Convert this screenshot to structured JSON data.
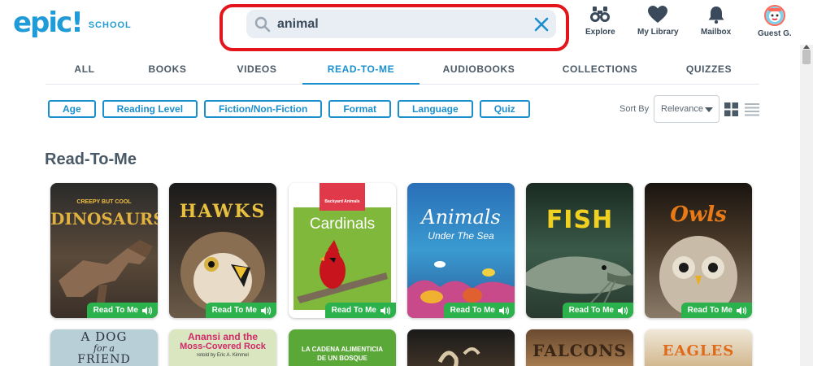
{
  "logo": {
    "word": "epic!",
    "sub": "SCHOOL"
  },
  "search": {
    "value": "animal",
    "placeholder": "Search"
  },
  "nav": {
    "explore": "Explore",
    "library": "My Library",
    "mailbox": "Mailbox",
    "guest": "Guest G."
  },
  "tabs": [
    {
      "label": "ALL"
    },
    {
      "label": "BOOKS"
    },
    {
      "label": "VIDEOS"
    },
    {
      "label": "READ-TO-ME"
    },
    {
      "label": "AUDIOBOOKS"
    },
    {
      "label": "COLLECTIONS"
    },
    {
      "label": "QUIZZES"
    }
  ],
  "active_tab": "READ-TO-ME",
  "filters": [
    "Age",
    "Reading Level",
    "Fiction/Non-Fiction",
    "Format",
    "Language",
    "Quiz"
  ],
  "sort": {
    "label": "Sort By",
    "value": "Relevance"
  },
  "section_title": "Read-To-Me",
  "badge_label": "Read To Me",
  "books_row1": [
    {
      "title": "DINOSAURS",
      "kicker": "CREEPY BUT COOL"
    },
    {
      "title": "HAWKS"
    },
    {
      "title": "Cardinals",
      "kicker": "Backyard Animals"
    },
    {
      "title": "Animals",
      "subtitle": "Under The Sea"
    },
    {
      "title": "FISH"
    },
    {
      "title": "Owls"
    }
  ],
  "books_row2": [
    {
      "title": "A DOG",
      "line2": "for a",
      "line3": "FRIEND"
    },
    {
      "title": "Anansi and the",
      "line2": "Moss-Covered Rock",
      "line3": "retold by Eric A. Kimmel"
    },
    {
      "title": "LA CADENA ALIMENTICIA",
      "line2": "DE UN BOSQUE"
    },
    {
      "title": ""
    },
    {
      "title": "FALCONS"
    },
    {
      "title": "EAGLES"
    }
  ],
  "colors": {
    "brand": "#1f9bd7",
    "accent": "#1a8fce",
    "badge": "#2bb24c",
    "search_outline": "#e3141c"
  }
}
